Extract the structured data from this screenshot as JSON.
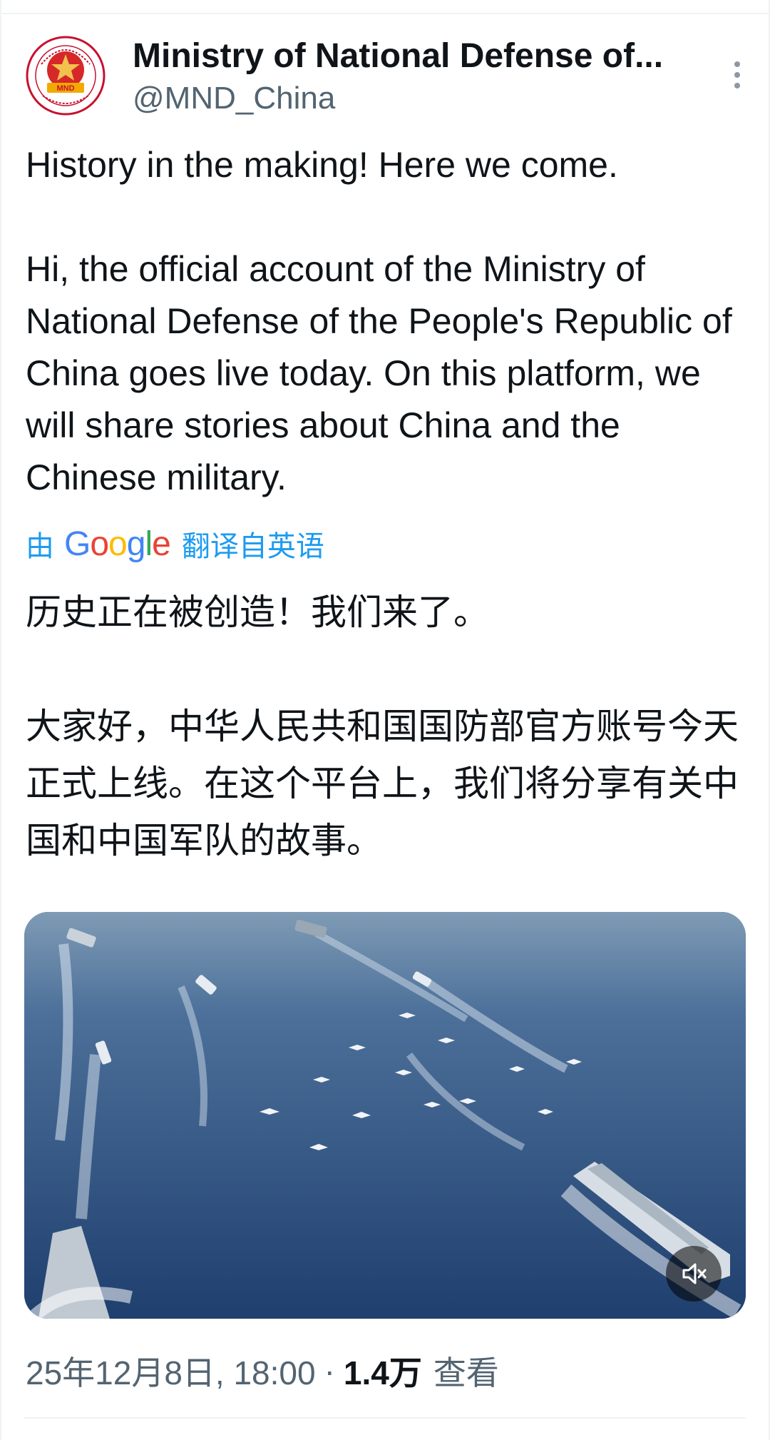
{
  "post": {
    "author": {
      "display_name": "Ministry of National Defense of...",
      "handle": "@MND_China",
      "avatar_icon": "mnd-emblem-icon",
      "avatar_text": "MND"
    },
    "more_icon": "more-vertical-icon",
    "text": {
      "line1": "History in the making! Here we come.",
      "paragraph2": "Hi, the official account of the Ministry of National Defense of the People's Republic of China goes live today. On this platform, we will share stories about China and the Chinese military."
    },
    "translation": {
      "prefix": "由",
      "brand": "Google",
      "suffix": "翻译自英语",
      "line1": "历史正在被创造！我们来了。",
      "paragraph2": "大家好，中华人民共和国国防部官方账号今天正式上线。在这个平台上，我们将分享有关中国和中国军队的故事。"
    },
    "media": {
      "type": "video",
      "mute_icon": "volume-muted-icon"
    },
    "meta": {
      "timestamp": "25年12月8日, 18:00",
      "separator": "·",
      "views_count": "1.4万",
      "views_label": "查看"
    },
    "colors": {
      "link": "#1d9bf0",
      "secondary_text": "#536471",
      "primary_text": "#0f1419"
    }
  }
}
